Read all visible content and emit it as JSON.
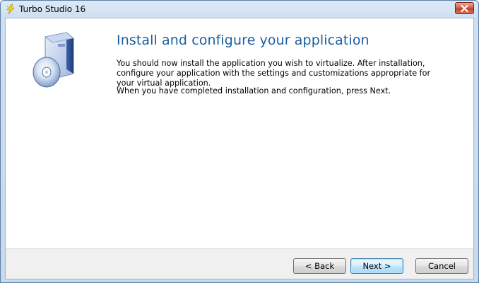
{
  "window": {
    "title": "Turbo Studio 16",
    "close_symbol": "✕"
  },
  "wizard": {
    "heading": "Install and configure your application",
    "paragraph1": "You should now install the application you wish to virtualize.  After installation, configure your application with the settings and customizations appropriate for your virtual application.",
    "paragraph2": "When you have completed installation and configuration, press Next.",
    "icon": "software-box-cd-icon"
  },
  "buttons": {
    "back": "< Back",
    "next": "Next >",
    "cancel": "Cancel"
  },
  "colors": {
    "heading": "#1a5fa0",
    "titlebar": "#cfdff0",
    "close": "#c1432c"
  }
}
